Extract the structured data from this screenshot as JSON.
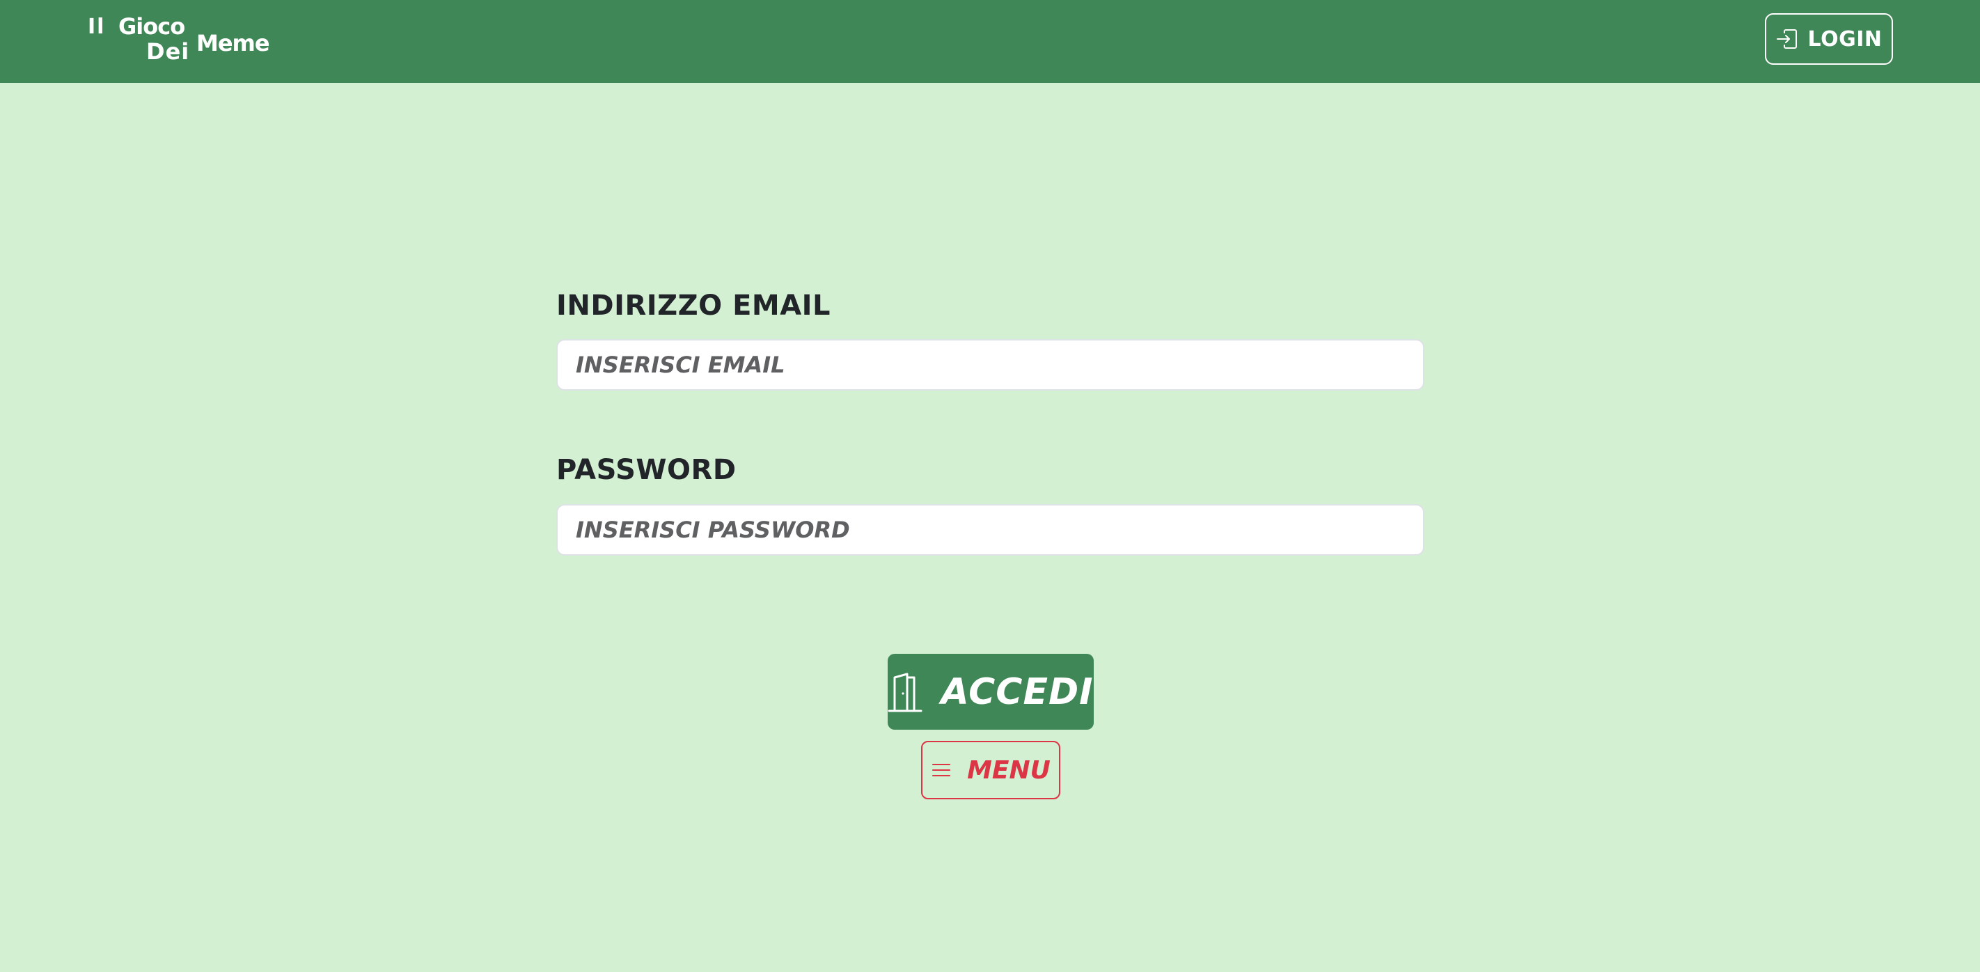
{
  "brand": {
    "words": [
      "Il",
      "Gioco",
      "Dei",
      "Meme"
    ]
  },
  "header": {
    "login_label": "LOGIN",
    "login_icon": "box-arrow-in-right-icon"
  },
  "form": {
    "email": {
      "label": "INDIRIZZO EMAIL",
      "placeholder": "INSERISCI EMAIL",
      "value": ""
    },
    "password": {
      "label": "PASSWORD",
      "placeholder": "INSERISCI PASSWORD",
      "value": ""
    }
  },
  "actions": {
    "submit_label": "ACCEDI",
    "submit_icon": "door-open-icon",
    "menu_label": "MENU",
    "menu_icon": "hamburger-list-icon"
  },
  "colors": {
    "navbar": "#408758",
    "background": "#d3f0d3",
    "primary_button": "#408758",
    "danger": "#dc3545"
  }
}
